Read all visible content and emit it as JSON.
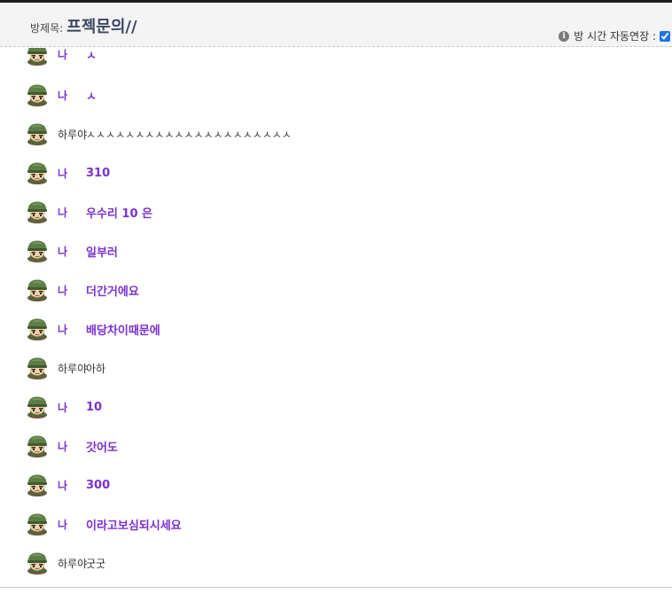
{
  "header": {
    "room_label": "방제목:",
    "room_title": "프젝문의//",
    "auto_extend_label": "방 시간 자동연장 :",
    "auto_extend_checked": true
  },
  "messages": [
    {
      "sender": "나",
      "text": "ㅅ",
      "type": "me",
      "avatar": "soldier-avatar-icon"
    },
    {
      "sender": "나",
      "text": "ㅅ",
      "type": "me",
      "avatar": "soldier-avatar-icon"
    },
    {
      "sender": "하루야",
      "text": "ㅅㅅㅅㅅㅅㅅㅅㅅㅅㅅㅅㅅㅅㅅㅅㅅㅅㅅㅅㅅㅅ",
      "type": "other",
      "avatar": "soldier-avatar-icon"
    },
    {
      "sender": "나",
      "text": "310",
      "type": "me",
      "avatar": "soldier-avatar-icon"
    },
    {
      "sender": "나",
      "text": "우수리 10 은",
      "type": "me",
      "avatar": "soldier-avatar-icon"
    },
    {
      "sender": "나",
      "text": "일부러",
      "type": "me",
      "avatar": "soldier-avatar-icon"
    },
    {
      "sender": "나",
      "text": "더간거에요",
      "type": "me",
      "avatar": "soldier-avatar-icon"
    },
    {
      "sender": "나",
      "text": "배당차이때문에",
      "type": "me",
      "avatar": "soldier-avatar-icon"
    },
    {
      "sender": "하루야",
      "text": "아하",
      "type": "other",
      "avatar": "soldier-avatar-icon"
    },
    {
      "sender": "나",
      "text": "10",
      "type": "me",
      "avatar": "soldier-avatar-icon"
    },
    {
      "sender": "나",
      "text": "갓어도",
      "type": "me",
      "avatar": "soldier-avatar-icon"
    },
    {
      "sender": "나",
      "text": "300",
      "type": "me",
      "avatar": "soldier-avatar-icon"
    },
    {
      "sender": "나",
      "text": "이라고보심되시세요",
      "type": "me",
      "avatar": "soldier-avatar-icon"
    },
    {
      "sender": "하루야",
      "text": "굿굿",
      "type": "other",
      "avatar": "soldier-avatar-icon"
    }
  ],
  "colors": {
    "me": "#7b2fd4",
    "other": "#333333",
    "title": "#3a4560"
  }
}
